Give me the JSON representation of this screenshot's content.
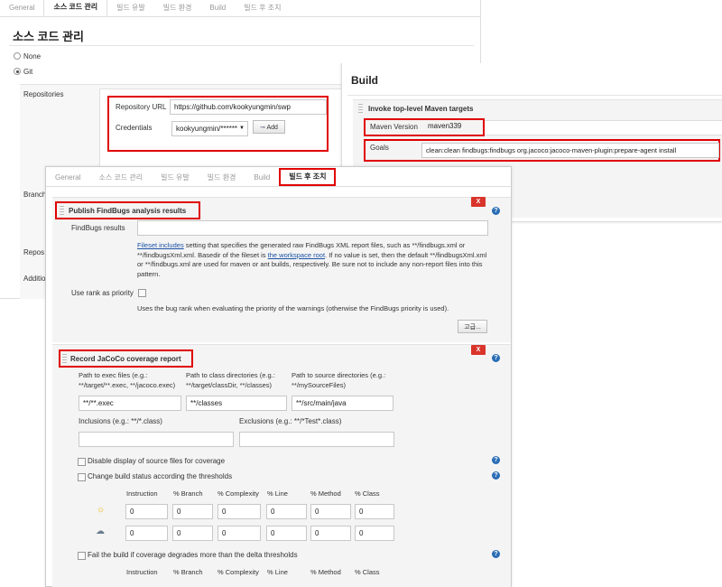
{
  "scm_panel": {
    "tabs": [
      "General",
      "소스 코드 관리",
      "빌드 유발",
      "빌드 환경",
      "Build",
      "빌드 후 조치"
    ],
    "active_tab": "소스 코드 관리",
    "title": "소스 코드 관리",
    "scm_options": {
      "none": "None",
      "git": "Git"
    },
    "labels": {
      "repositories": "Repositories",
      "branch": "Branch",
      "repos": "Repos",
      "additional": "Additio"
    },
    "repository_url_label": "Repository URL",
    "repository_url_value": "https://github.com/kookyungmin/swp",
    "credentials_label": "Credentials",
    "credentials_value": "kookyungmin/******",
    "add_button": "Add"
  },
  "build_panel": {
    "title": "Build",
    "step_title": "Invoke top-level Maven targets",
    "maven_version_label": "Maven Version",
    "maven_version_value": "maven339",
    "goals_label": "Goals",
    "goals_value": "clean:clean findbugs:findbugs org.jacoco:jacoco-maven-plugin:prepare-agent install"
  },
  "post_panel": {
    "tabs": [
      "General",
      "소스 코드 관리",
      "빌드 유발",
      "빌드 환경",
      "Build",
      "빌드 후 조치"
    ],
    "active_tab": "빌드 후 조치",
    "delete_label": "X",
    "help_label": "?",
    "findbugs": {
      "title": "Publish FindBugs analysis results",
      "results_label": "FindBugs results",
      "desc_link1": "Fileset includes",
      "desc_part1": " setting that specifies the generated raw FindBugs XML report files, such as **/findbugs.xml or **/findbugsXml.xml. Basedir of the fileset is ",
      "desc_link2": "the workspace root",
      "desc_part2": ". If no value is set, then the default **/findbugsXml.xml or **/findbugs.xml are used for maven or ant builds, respectively. Be sure not to include any non-report files into this pattern.",
      "use_rank_label": "Use rank as priority",
      "use_rank_desc": "Uses the bug rank when evaluating the priority of the warnings (otherwise the FindBugs priority is used).",
      "advanced_button": "고급..."
    },
    "jacoco": {
      "title": "Record JaCoCo coverage report",
      "exec_label": "Path to exec files (e.g.: **/target/**.exec, **/jacoco.exec)",
      "exec_value": "**/**.exec",
      "class_label": "Path to class directories (e.g.: **/target/classDir, **/classes)",
      "class_value": "**/classes",
      "source_label": "Path to source directories (e.g.: **/mySourceFiles)",
      "source_value": "**/src/main/java",
      "inclusions_label": "Inclusions (e.g.: **/*.class)",
      "exclusions_label": "Exclusions (e.g.: **/*Test*.class)",
      "disable_source_label": "Disable display of source files for coverage",
      "change_status_label": "Change build status according the thresholds",
      "threshold_headers": [
        "Instruction",
        "% Branch",
        "% Complexity",
        "% Line",
        "% Method",
        "% Class"
      ],
      "healthy_icon": "sun-icon",
      "unhealthy_icon": "cloud-icon",
      "healthy_values": [
        "0",
        "0",
        "0",
        "0",
        "0",
        "0"
      ],
      "unhealthy_values": [
        "0",
        "0",
        "0",
        "0",
        "0",
        "0"
      ],
      "delta_label": "Fail the build if coverage degrades more than the delta thresholds",
      "delta_headers": [
        "Instruction",
        "% Branch",
        "% Complexity",
        "% Line",
        "% Method",
        "% Class"
      ]
    }
  },
  "colors": {
    "highlight_red": "#e00000",
    "link_blue": "#1a52a6",
    "delete_red": "#d9342b"
  }
}
